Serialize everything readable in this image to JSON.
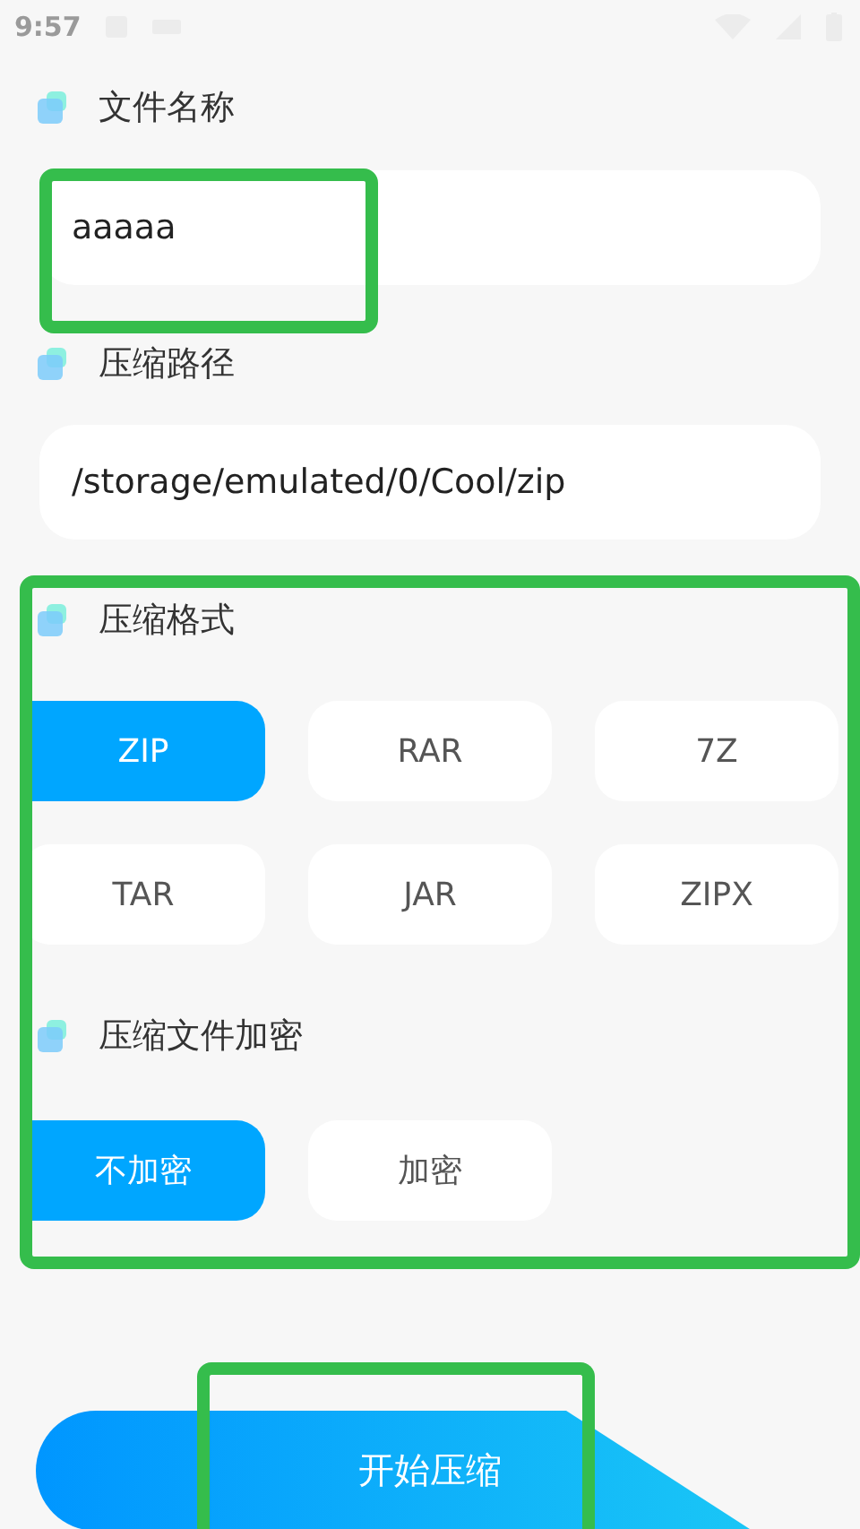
{
  "status_bar": {
    "time": "9:57"
  },
  "file_name": {
    "label": "文件名称",
    "value": "aaaaa"
  },
  "path": {
    "label": "压缩路径",
    "value": "/storage/emulated/0/Cool/zip"
  },
  "format": {
    "label": "压缩格式",
    "options": [
      {
        "label": "ZIP",
        "selected": true
      },
      {
        "label": "RAR",
        "selected": false
      },
      {
        "label": "7Z",
        "selected": false
      },
      {
        "label": "TAR",
        "selected": false
      },
      {
        "label": "JAR",
        "selected": false
      },
      {
        "label": "ZIPX",
        "selected": false
      }
    ]
  },
  "encryption": {
    "label": "压缩文件加密",
    "options": [
      {
        "label": "不加密",
        "selected": true
      },
      {
        "label": "加密",
        "selected": false
      }
    ]
  },
  "start_button": {
    "label": "开始压缩"
  }
}
